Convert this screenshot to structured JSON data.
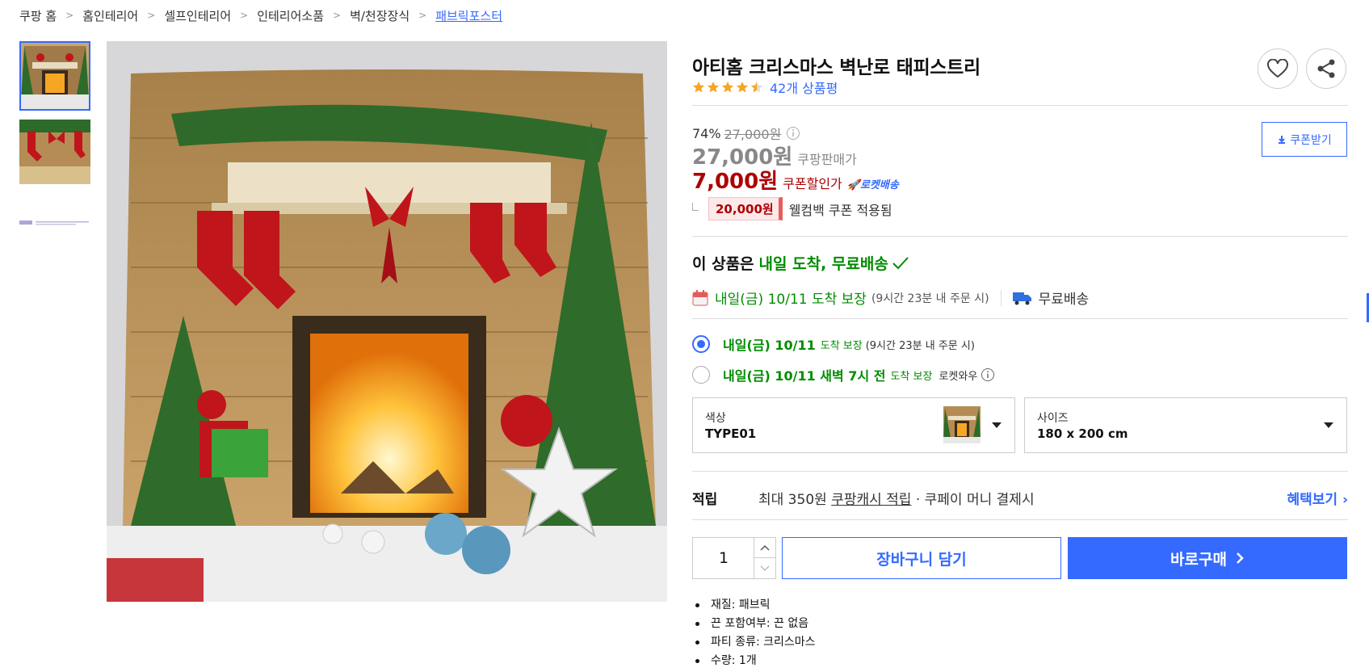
{
  "breadcrumb": [
    "쿠팡 홈",
    "홈인테리어",
    "셀프인테리어",
    "인테리어소품",
    "벽/천장장식",
    "패브릭포스터"
  ],
  "product": {
    "title": "아티홈 크리스마스 벽난로 태피스트리",
    "rating": 4.5,
    "review_count": "42개 상품평"
  },
  "price": {
    "discount_rate": "74%",
    "original": "27,000원",
    "coupang_price": "27,000원",
    "coupang_price_label": "쿠팡판매가",
    "coupon_price": "7,000원",
    "coupon_price_label": "쿠폰할인가",
    "rocket_label": "로켓배송",
    "coupon_button": "쿠폰받기",
    "welcome_amount": "20,000원",
    "welcome_text": "웰컴백 쿠폰 적용됨"
  },
  "delivery": {
    "headline_prefix": "이 상품은",
    "headline_green": "내일 도착, 무료배송",
    "date_text": "내일(금) 10/11 도착 보장",
    "date_note": "(9시간 23분 내 주문 시)",
    "free_shipping": "무료배송",
    "options": [
      {
        "date": "내일(금) 10/11",
        "suffix": "도착 보장",
        "note": "(9시간 23분 내 주문 시)",
        "selected": true
      },
      {
        "date": "내일(금) 10/11 새벽 7시 전",
        "suffix": "도착 보장",
        "note": "로켓와우",
        "selected": false
      }
    ]
  },
  "selects": {
    "color_label": "색상",
    "color_value": "TYPE01",
    "size_label": "사이즈",
    "size_value": "180 x 200 cm"
  },
  "points": {
    "label": "적립",
    "text_prefix": "최대 350원",
    "text_link": "쿠팡캐시 적립",
    "text_suffix": "· 쿠페이 머니 결제시",
    "more": "혜택보기"
  },
  "purchase": {
    "quantity": "1",
    "cart_label": "장바구니 담기",
    "buy_label": "바로구매"
  },
  "attributes": [
    "재질: 패브릭",
    "끈 포함여부: 끈 없음",
    "파티 종류: 크리스마스",
    "수량: 1개"
  ],
  "colors": {
    "accent": "#346aff",
    "price_red": "#ae0000",
    "green": "#008c00"
  }
}
